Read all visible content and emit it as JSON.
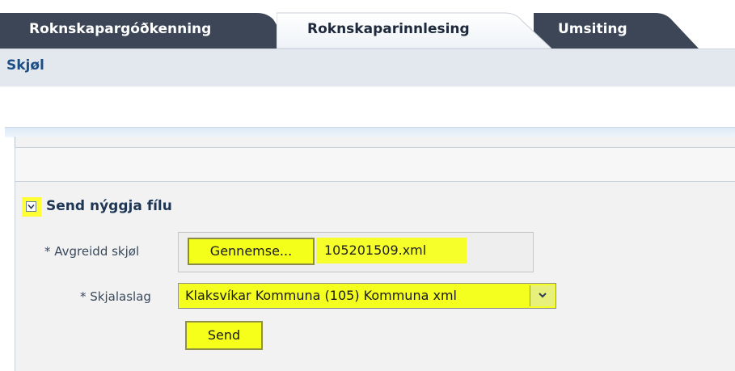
{
  "tabs": [
    {
      "label": "Roknskapargóðkenning",
      "active": false
    },
    {
      "label": "Roknskaparinnlesing",
      "active": true
    },
    {
      "label": "Umsiting",
      "active": false
    }
  ],
  "subheader": {
    "title": "Skjøl"
  },
  "section": {
    "title": "Send nýggja fílu",
    "disclose_icon": "chevron-down-icon"
  },
  "form": {
    "file_label": "Avgreidd skjøl",
    "required_mark": "*",
    "browse_label": "Gennemse...",
    "file_value": "105201509.xml",
    "type_label": "Skjalaslag",
    "type_value": "Klaksvíkar Kommuna (105) Kommuna xml",
    "send_label": "Send"
  },
  "colors": {
    "highlight": "#f3ff1c",
    "tab_dark": "#3c4656",
    "accent_text": "#1d4f86"
  }
}
